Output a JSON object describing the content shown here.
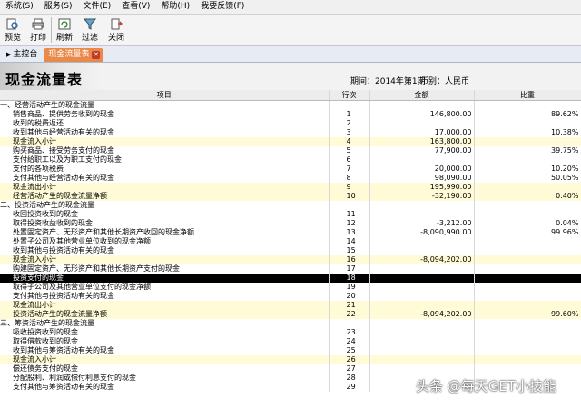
{
  "menu": [
    "系统(S)",
    "服务(S)",
    "文件(E)",
    "查看(V)",
    "帮助(H)",
    "我要反馈(F)"
  ],
  "toolbar": [
    {
      "label": "预览",
      "icon": "preview-icon"
    },
    {
      "label": "打印",
      "icon": "print-icon"
    },
    {
      "label": "刷新",
      "icon": "refresh-icon"
    },
    {
      "label": "过滤",
      "icon": "filter-icon"
    },
    {
      "label": "关闭",
      "icon": "close-icon"
    }
  ],
  "tabs": [
    {
      "label": "主控台",
      "active": false
    },
    {
      "label": "现金流量表",
      "active": true
    }
  ],
  "report": {
    "title": "现金流量表",
    "period": "期间：2014年第1期",
    "currency": "币别：人民币"
  },
  "columns": {
    "item": "项目",
    "no": "行次",
    "amount": "金额",
    "pct": "比重"
  },
  "rows": [
    {
      "item": "一、经营活动产生的现金流量",
      "indent": 0,
      "no": "",
      "amount": "",
      "pct": "",
      "hl": false
    },
    {
      "item": "销售商品、提供劳务收到的现金",
      "indent": 1,
      "no": "1",
      "amount": "146,800.00",
      "pct": "89.62%",
      "hl": false
    },
    {
      "item": "收到的税费返还",
      "indent": 1,
      "no": "2",
      "amount": "",
      "pct": "",
      "hl": false
    },
    {
      "item": "收到其他与经营活动有关的现金",
      "indent": 1,
      "no": "3",
      "amount": "17,000.00",
      "pct": "10.38%",
      "hl": false
    },
    {
      "item": "现金流入小计",
      "indent": 1,
      "no": "4",
      "amount": "163,800.00",
      "pct": "",
      "hl": true
    },
    {
      "item": "购买商品、接受劳务支付的现金",
      "indent": 1,
      "no": "5",
      "amount": "77,900.00",
      "pct": "39.75%",
      "hl": false
    },
    {
      "item": "支付给职工以及为职工支付的现金",
      "indent": 1,
      "no": "6",
      "amount": "",
      "pct": "",
      "hl": false
    },
    {
      "item": "支付的各项税费",
      "indent": 1,
      "no": "7",
      "amount": "20,000.00",
      "pct": "10.20%",
      "hl": false
    },
    {
      "item": "支付其他与经营活动有关的现金",
      "indent": 1,
      "no": "8",
      "amount": "98,090.00",
      "pct": "50.05%",
      "hl": false
    },
    {
      "item": "现金流出小计",
      "indent": 1,
      "no": "9",
      "amount": "195,990.00",
      "pct": "",
      "hl": true
    },
    {
      "item": "经营活动产生的现金流量净额",
      "indent": 1,
      "no": "10",
      "amount": "-32,190.00",
      "pct": "0.40%",
      "hl": true
    },
    {
      "item": "二、投资活动产生的现金流量",
      "indent": 0,
      "no": "",
      "amount": "",
      "pct": "",
      "hl": false
    },
    {
      "item": "收回投资收到的现金",
      "indent": 1,
      "no": "11",
      "amount": "",
      "pct": "",
      "hl": false
    },
    {
      "item": "取得投资收益收到的现金",
      "indent": 1,
      "no": "12",
      "amount": "-3,212.00",
      "pct": "0.04%",
      "hl": false
    },
    {
      "item": "处置固定资产、无形资产和其他长期资产收回的现金净额",
      "indent": 1,
      "no": "13",
      "amount": "-8,090,990.00",
      "pct": "99.96%",
      "hl": false
    },
    {
      "item": "处置子公司及其他营业单位收到的现金净额",
      "indent": 1,
      "no": "14",
      "amount": "",
      "pct": "",
      "hl": false
    },
    {
      "item": "收到其他与投资活动有关的现金",
      "indent": 1,
      "no": "15",
      "amount": "",
      "pct": "",
      "hl": false
    },
    {
      "item": "现金流入小计",
      "indent": 1,
      "no": "16",
      "amount": "-8,094,202.00",
      "pct": "",
      "hl": true
    },
    {
      "item": "购建固定资产、无形资产和其他长期资产支付的现金",
      "indent": 1,
      "no": "17",
      "amount": "",
      "pct": "",
      "hl": false
    },
    {
      "item": "投资支付的现金",
      "indent": 1,
      "no": "18",
      "amount": "",
      "pct": "",
      "hl": false,
      "sel": true
    },
    {
      "item": "取得子公司及其他营业单位支付的现金净额",
      "indent": 1,
      "no": "19",
      "amount": "",
      "pct": "",
      "hl": false
    },
    {
      "item": "支付其他与投资活动有关的现金",
      "indent": 1,
      "no": "20",
      "amount": "",
      "pct": "",
      "hl": false
    },
    {
      "item": "现金流出小计",
      "indent": 1,
      "no": "21",
      "amount": "",
      "pct": "",
      "hl": true
    },
    {
      "item": "投资活动产生的现金流量净额",
      "indent": 1,
      "no": "22",
      "amount": "-8,094,202.00",
      "pct": "99.60%",
      "hl": true
    },
    {
      "item": "三、筹资活动产生的现金流量",
      "indent": 0,
      "no": "",
      "amount": "",
      "pct": "",
      "hl": false
    },
    {
      "item": "吸收投资收到的现金",
      "indent": 1,
      "no": "23",
      "amount": "",
      "pct": "",
      "hl": false
    },
    {
      "item": "取得借款收到的现金",
      "indent": 1,
      "no": "24",
      "amount": "",
      "pct": "",
      "hl": false
    },
    {
      "item": "收到其他与筹资活动有关的现金",
      "indent": 1,
      "no": "25",
      "amount": "",
      "pct": "",
      "hl": false
    },
    {
      "item": "现金流入小计",
      "indent": 1,
      "no": "26",
      "amount": "",
      "pct": "",
      "hl": true
    },
    {
      "item": "偿还债务支付的现金",
      "indent": 1,
      "no": "27",
      "amount": "",
      "pct": "",
      "hl": false
    },
    {
      "item": "分配股利、利润或偿付利息支付的现金",
      "indent": 1,
      "no": "28",
      "amount": "",
      "pct": "",
      "hl": false
    },
    {
      "item": "支付其他与筹资活动有关的现金",
      "indent": 1,
      "no": "29",
      "amount": "",
      "pct": "",
      "hl": false
    }
  ],
  "watermark": "头条 @每天GET小技能"
}
